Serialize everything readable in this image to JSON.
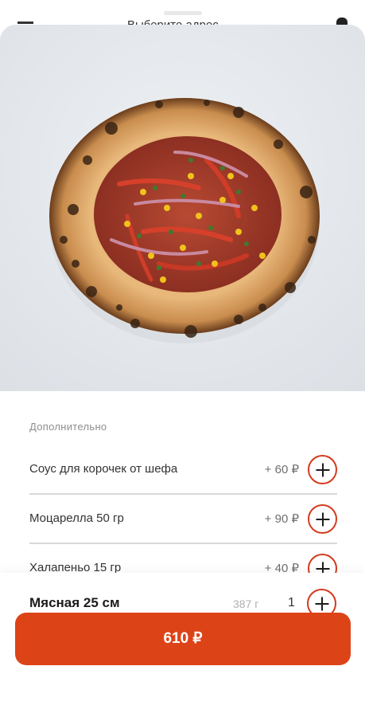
{
  "background_header": {
    "title": "Выберите адрес",
    "menu_icon": "menu-icon",
    "cart_icon": "bag-icon"
  },
  "product": {
    "image_alt": "pizza-photo",
    "name": "Мясная 25 см",
    "weight": "387 г",
    "quantity": "1"
  },
  "extras": {
    "section_label": "Дополнительно",
    "items": [
      {
        "name": "Соус для корочек от шефа",
        "price": "+ 60 ₽"
      },
      {
        "name": "Моцарелла 50 гр",
        "price": "+ 90 ₽"
      },
      {
        "name": "Халапеньо 15 гр",
        "price": "+ 40 ₽"
      }
    ]
  },
  "order_button": {
    "label": "610 ₽"
  },
  "colors": {
    "accent": "#dc4418",
    "plus_border": "#d43b1e",
    "divider": "#d8d8d8"
  }
}
